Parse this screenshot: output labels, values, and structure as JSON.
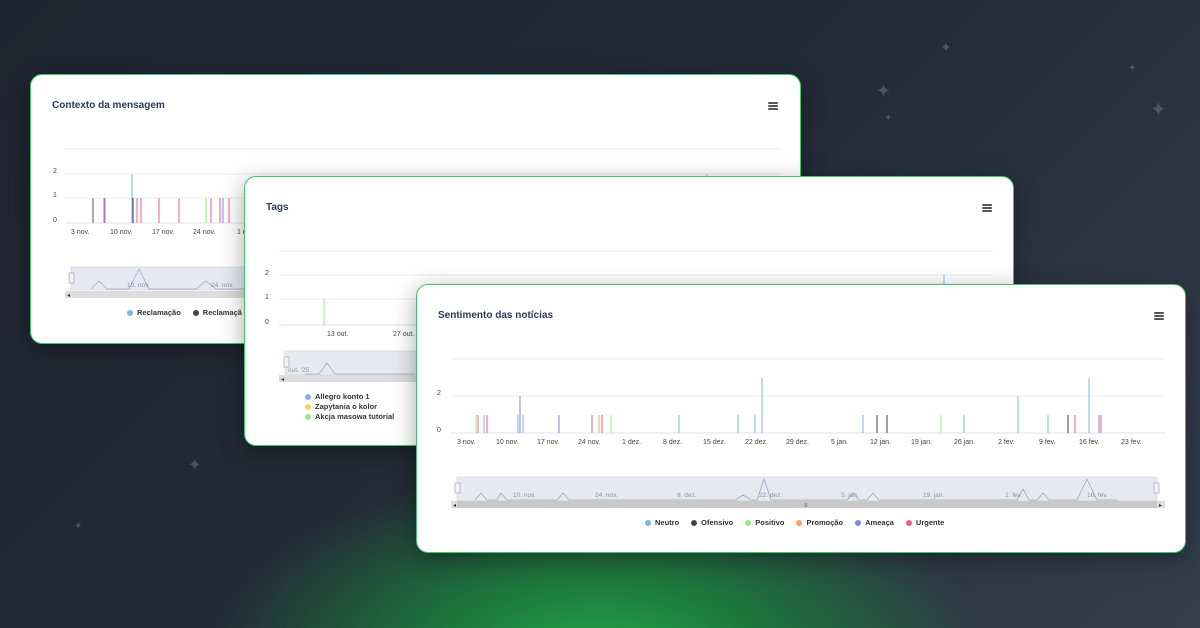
{
  "colors": {
    "neutro": "#7cb5ec",
    "ofensivo": "#434348",
    "positivo": "#90ed7d",
    "promocao": "#f7a35c",
    "ameaca": "#8085e9",
    "urgente": "#f15c80",
    "card_border": "#3ec66a"
  },
  "card1": {
    "title": "Contexto da mensagem",
    "y_ticks": [
      "2",
      "1",
      "0"
    ],
    "x_ticks": [
      "3 nov.",
      "10 nov.",
      "17 nov.",
      "24 nov.",
      "1 d"
    ],
    "navigator_labels": [
      "10. nov.",
      "24. nov."
    ],
    "legend": [
      {
        "label": "Reclamação",
        "color": "#7cb5ec"
      },
      {
        "label": "Reclamaçã",
        "color": "#434348"
      }
    ]
  },
  "card2": {
    "title": "Tags",
    "y_ticks": [
      "2",
      "1",
      "0"
    ],
    "x_ticks": [
      "13 out.",
      "27 out."
    ],
    "navigator_labels": [
      "out. '25"
    ],
    "legend": [
      {
        "label": "Allegro konto 1",
        "color": "#7cb5ec"
      },
      {
        "label": "Zapytania o kolor",
        "color": "#f7d35c"
      },
      {
        "label": "Akcja masowa tutorial",
        "color": "#90ed7d"
      }
    ]
  },
  "card3": {
    "title": "Sentimento das notícias",
    "y_ticks": [
      "2",
      "0"
    ],
    "x_ticks": [
      "3 nov.",
      "10 nov.",
      "17 nov.",
      "24 nov.",
      "1 dez.",
      "8 dez.",
      "15 dez.",
      "22 dez.",
      "29 dez.",
      "5 jan.",
      "12 jan.",
      "19 jan.",
      "26 jan.",
      "2 fev.",
      "9 fev.",
      "16 fev.",
      "23 fev."
    ],
    "navigator_labels": [
      "10. nov.",
      "24. nov.",
      "8. dez.",
      "22. dez.",
      "5. jan.",
      "19. jan.",
      "2. fev.",
      "16. fev."
    ],
    "legend": [
      {
        "label": "Neutro",
        "color": "#7cb5ec"
      },
      {
        "label": "Ofensivo",
        "color": "#434348"
      },
      {
        "label": "Positivo",
        "color": "#90ed7d"
      },
      {
        "label": "Promoção",
        "color": "#f7a35c"
      },
      {
        "label": "Ameaça",
        "color": "#8085e9"
      },
      {
        "label": "Urgente",
        "color": "#f15c80"
      }
    ]
  }
}
